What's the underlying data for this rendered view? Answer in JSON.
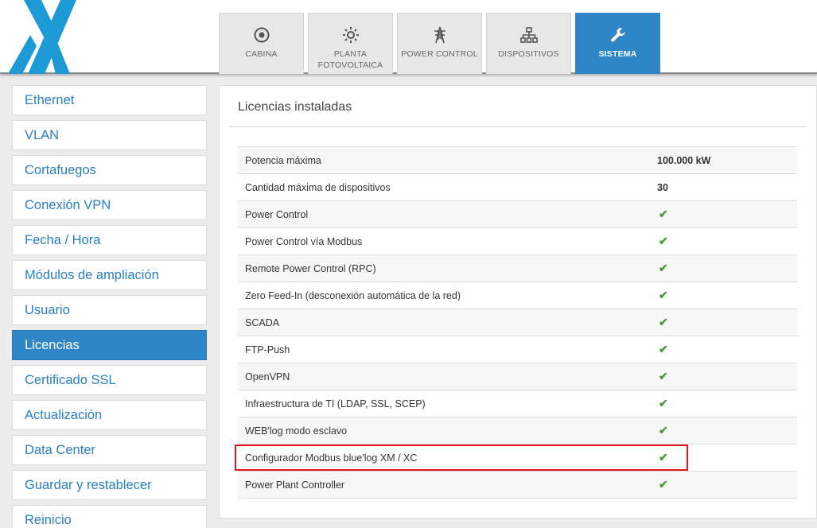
{
  "colors": {
    "accent": "#2f86c6",
    "check": "#4a9c3a",
    "highlight": "#e0161b"
  },
  "tabs": [
    {
      "label": "CABINA",
      "icon": "target-icon"
    },
    {
      "label": "PLANTA\nFOTOVOLTAICA",
      "icon": "sun-icon"
    },
    {
      "label": "POWER CONTROL",
      "icon": "power-tower-icon"
    },
    {
      "label": "DISPOSITIVOS",
      "icon": "network-tree-icon"
    },
    {
      "label": "SISTEMA",
      "icon": "wrench-icon",
      "active": true
    }
  ],
  "sidebar": {
    "items": [
      {
        "label": "Ethernet"
      },
      {
        "label": "VLAN"
      },
      {
        "label": "Cortafuegos"
      },
      {
        "label": "Conexión VPN"
      },
      {
        "label": "Fecha / Hora"
      },
      {
        "label": "Módulos de ampliación"
      },
      {
        "label": "Usuario"
      },
      {
        "label": "Licencias",
        "active": true
      },
      {
        "label": "Certificado SSL"
      },
      {
        "label": "Actualización"
      },
      {
        "label": "Data Center"
      },
      {
        "label": "Guardar y restablecer"
      },
      {
        "label": "Reinicio"
      }
    ]
  },
  "main": {
    "title": "Licencias instaladas",
    "licenses": [
      {
        "name": "Potencia máxima",
        "value": "100.000 kW"
      },
      {
        "name": "Cantidad máxima de dispositivos",
        "value": "30"
      },
      {
        "name": "Power Control",
        "enabled": true
      },
      {
        "name": "Power Control vía Modbus",
        "enabled": true
      },
      {
        "name": "Remote Power Control (RPC)",
        "enabled": true
      },
      {
        "name": "Zero Feed-In (desconexión automática de la red)",
        "enabled": true
      },
      {
        "name": "SCADA",
        "enabled": true
      },
      {
        "name": "FTP-Push",
        "enabled": true
      },
      {
        "name": "OpenVPN",
        "enabled": true
      },
      {
        "name": "Infraestructura de TI (LDAP, SSL, SCEP)",
        "enabled": true
      },
      {
        "name": "WEB'log modo esclavo",
        "enabled": true
      },
      {
        "name": "Configurador Modbus blue'log XM / XC",
        "enabled": true,
        "highlighted": true
      },
      {
        "name": "Power Plant Controller",
        "enabled": true
      }
    ]
  }
}
